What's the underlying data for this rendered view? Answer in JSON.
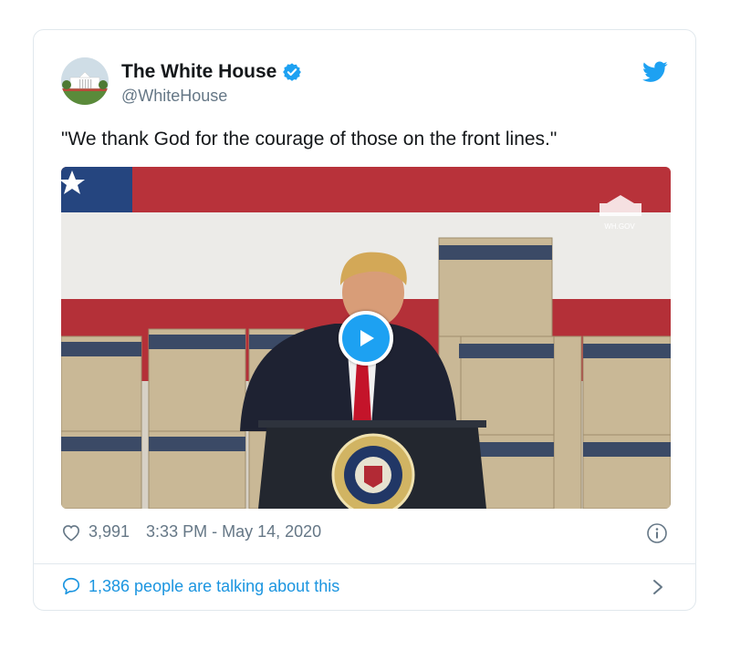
{
  "tweet": {
    "author_name": "The White House",
    "handle": "@WhiteHouse",
    "text": "\"We thank God for the courage of those on the front lines.\"",
    "likes": "3,991",
    "timestamp": "3:33 PM - May 14, 2020",
    "talking": "1,386 people are talking about this"
  },
  "media": {
    "watermark": "WH.GOV"
  },
  "colors": {
    "twitter_blue": "#1da1f2",
    "link_blue": "#1b95e0",
    "verified_blue": "#1da1f2",
    "muted_gray": "#657786"
  },
  "icons": {
    "verified": "verified-badge-icon",
    "brand": "twitter-bird-icon",
    "like": "heart-icon",
    "info": "info-icon",
    "reply": "speech-bubble-icon",
    "chevron": "chevron-right-icon",
    "play": "play-icon"
  }
}
